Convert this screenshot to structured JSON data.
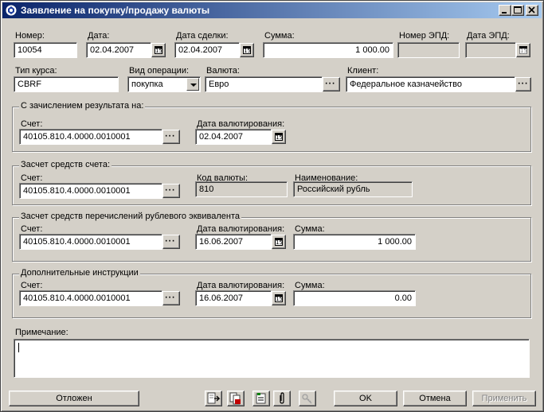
{
  "window": {
    "title": "Заявление на покупку/продажу валюты"
  },
  "header": {
    "nomer_label": "Номер:",
    "nomer_value": "10054",
    "data_label": "Дата:",
    "data_value": "02.04.2007",
    "data_sdelki_label": "Дата сделки:",
    "data_sdelki_value": "02.04.2007",
    "summa_label": "Сумма:",
    "summa_value": "1 000.00",
    "nomer_epd_label": "Номер ЭПД:",
    "nomer_epd_value": "",
    "data_epd_label": "Дата ЭПД:",
    "data_epd_value": "",
    "tip_kursa_label": "Тип курса:",
    "tip_kursa_value": "CBRF",
    "vid_operacii_label": "Вид операции:",
    "vid_operacii_value": "покупка",
    "valuta_label": "Валюта:",
    "valuta_value": "Евро",
    "klient_label": "Клиент:",
    "klient_value": "Федеральное казначейство"
  },
  "calendar_icon_text": "15",
  "group1": {
    "title": "С зачислением результата на:",
    "schet_label": "Счет:",
    "schet_value": "40105.810.4.0000.0010001",
    "data_val_label": "Дата валютирования:",
    "data_val_value": "02.04.2007"
  },
  "group2": {
    "title": "Засчет средств счета:",
    "schet_label": "Счет:",
    "schet_value": "40105.810.4.0000.0010001",
    "kod_label": "Код валюты:",
    "kod_value": "810",
    "naim_label": "Наименование:",
    "naim_value": "Российский рубль"
  },
  "group3": {
    "title": "Засчет средств перечислений рублевого эквивалента",
    "schet_label": "Счет:",
    "schet_value": "40105.810.4.0000.0010001",
    "data_val_label": "Дата валютирования:",
    "data_val_value": "16.06.2007",
    "summa_label": "Сумма:",
    "summa_value": "1 000.00"
  },
  "group4": {
    "title": "Дополнительные инструкции",
    "schet_label": "Счет:",
    "schet_value": "40105.810.4.0000.0010001",
    "data_val_label": "Дата валютирования:",
    "data_val_value": "16.06.2007",
    "summa_label": "Сумма:",
    "summa_value": "0.00"
  },
  "note": {
    "label": "Примечание:",
    "value": ""
  },
  "footer": {
    "postponed_label": "Отложен",
    "ok_label": "OK",
    "cancel_label": "Отмена",
    "apply_label": "Применить"
  }
}
